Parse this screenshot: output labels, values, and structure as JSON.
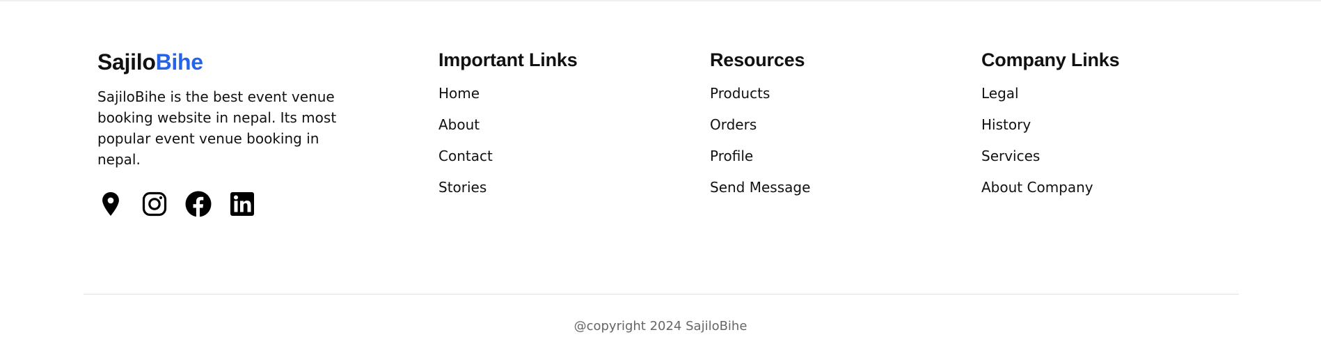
{
  "brand": {
    "part1": "Sajilo",
    "part2": "Bihe",
    "accent_color": "#2563eb",
    "description": "SajiloBihe is the best event venue booking website in nepal. Its most popular event venue booking in nepal."
  },
  "socials": [
    {
      "icon": "location-pin-icon"
    },
    {
      "icon": "instagram-icon"
    },
    {
      "icon": "facebook-icon"
    },
    {
      "icon": "linkedin-icon"
    }
  ],
  "important_links": {
    "heading": "Important Links",
    "items": [
      "Home",
      "About",
      "Contact",
      "Stories"
    ]
  },
  "resources": {
    "heading": "Resources",
    "items": [
      "Products",
      "Orders",
      "Profile",
      "Send Message"
    ]
  },
  "company_links": {
    "heading": "Company Links",
    "items": [
      "Legal",
      "History",
      "Services",
      "About Company"
    ]
  },
  "copyright": "@copyright 2024 SajiloBihe"
}
